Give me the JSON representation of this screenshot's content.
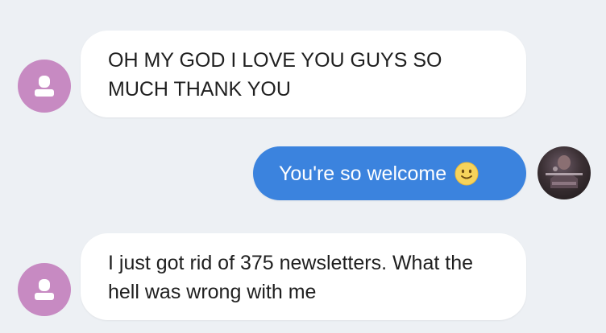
{
  "messages": [
    {
      "direction": "incoming",
      "avatar": "generic-user-icon",
      "text": "OH MY GOD I LOVE YOU GUYS SO MUCH THANK YOU"
    },
    {
      "direction": "outgoing",
      "avatar": "user-photo",
      "text": "You're so welcome",
      "emoji": "smiling-face-icon"
    },
    {
      "direction": "incoming",
      "avatar": "generic-user-icon",
      "text": "I just got rid of 375 newsletters. What the hell was wrong with me"
    }
  ],
  "colors": {
    "background": "#edf0f4",
    "incoming_bubble": "#ffffff",
    "outgoing_bubble": "#3b83de",
    "generic_avatar": "#c78ac2"
  }
}
